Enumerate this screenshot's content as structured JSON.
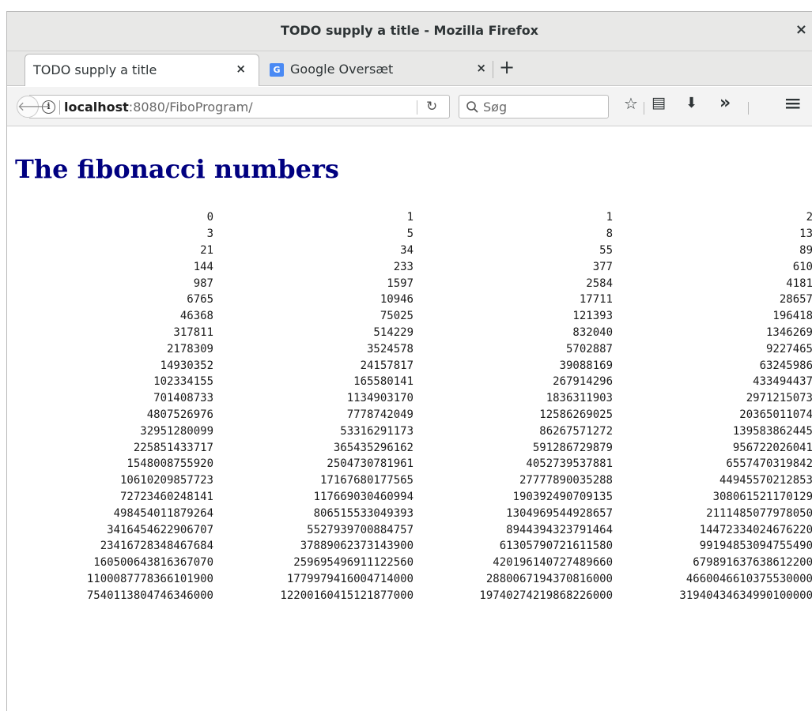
{
  "window": {
    "title": "TODO supply a title - Mozilla Firefox",
    "close_glyph": "×"
  },
  "tabs": [
    {
      "label": "TODO supply a title",
      "close_glyph": "×",
      "active": true
    },
    {
      "label": "Google Oversæt",
      "close_glyph": "×",
      "active": false,
      "icon": "google-translate-icon",
      "icon_color": "#4a8af4"
    }
  ],
  "new_tab_glyph": "+",
  "navbar": {
    "back_glyph": "🡐",
    "info_glyph": "i",
    "url_host": "localhost",
    "url_rest": ":8080/FiboProgram/",
    "reload_glyph": "↻",
    "search_placeholder": "Søg",
    "bookmark_glyph": "☆",
    "library_glyph": "▤",
    "downloads_glyph": "⬇",
    "overflow_glyph": "»",
    "menu_glyph": "≡"
  },
  "page": {
    "heading": "The fibonacci numbers",
    "heading_color": "#000080",
    "rows": [
      [
        "0",
        "1",
        "1",
        "2"
      ],
      [
        "3",
        "5",
        "8",
        "13"
      ],
      [
        "21",
        "34",
        "55",
        "89"
      ],
      [
        "144",
        "233",
        "377",
        "610"
      ],
      [
        "987",
        "1597",
        "2584",
        "4181"
      ],
      [
        "6765",
        "10946",
        "17711",
        "28657"
      ],
      [
        "46368",
        "75025",
        "121393",
        "196418"
      ],
      [
        "317811",
        "514229",
        "832040",
        "1346269"
      ],
      [
        "2178309",
        "3524578",
        "5702887",
        "9227465"
      ],
      [
        "14930352",
        "24157817",
        "39088169",
        "63245986"
      ],
      [
        "102334155",
        "165580141",
        "267914296",
        "433494437"
      ],
      [
        "701408733",
        "1134903170",
        "1836311903",
        "2971215073"
      ],
      [
        "4807526976",
        "7778742049",
        "12586269025",
        "20365011074"
      ],
      [
        "32951280099",
        "53316291173",
        "86267571272",
        "139583862445"
      ],
      [
        "225851433717",
        "365435296162",
        "591286729879",
        "956722026041"
      ],
      [
        "1548008755920",
        "2504730781961",
        "4052739537881",
        "6557470319842"
      ],
      [
        "10610209857723",
        "17167680177565",
        "27777890035288",
        "44945570212853"
      ],
      [
        "72723460248141",
        "117669030460994",
        "190392490709135",
        "308061521170129"
      ],
      [
        "498454011879264",
        "806515533049393",
        "1304969544928657",
        "2111485077978050"
      ],
      [
        "3416454622906707",
        "5527939700884757",
        "8944394323791464",
        "14472334024676220"
      ],
      [
        "23416728348467684",
        "37889062373143900",
        "61305790721611580",
        "99194853094755490"
      ],
      [
        "160500643816367070",
        "259695496911122560",
        "420196140727489660",
        "679891637638612200"
      ],
      [
        "1100087778366101900",
        "1779979416004714000",
        "2880067194370816000",
        "4660046610375530000"
      ],
      [
        "7540113804746346000",
        "12200160415121877000",
        "19740274219868226000",
        "31940434634990100000"
      ]
    ]
  }
}
